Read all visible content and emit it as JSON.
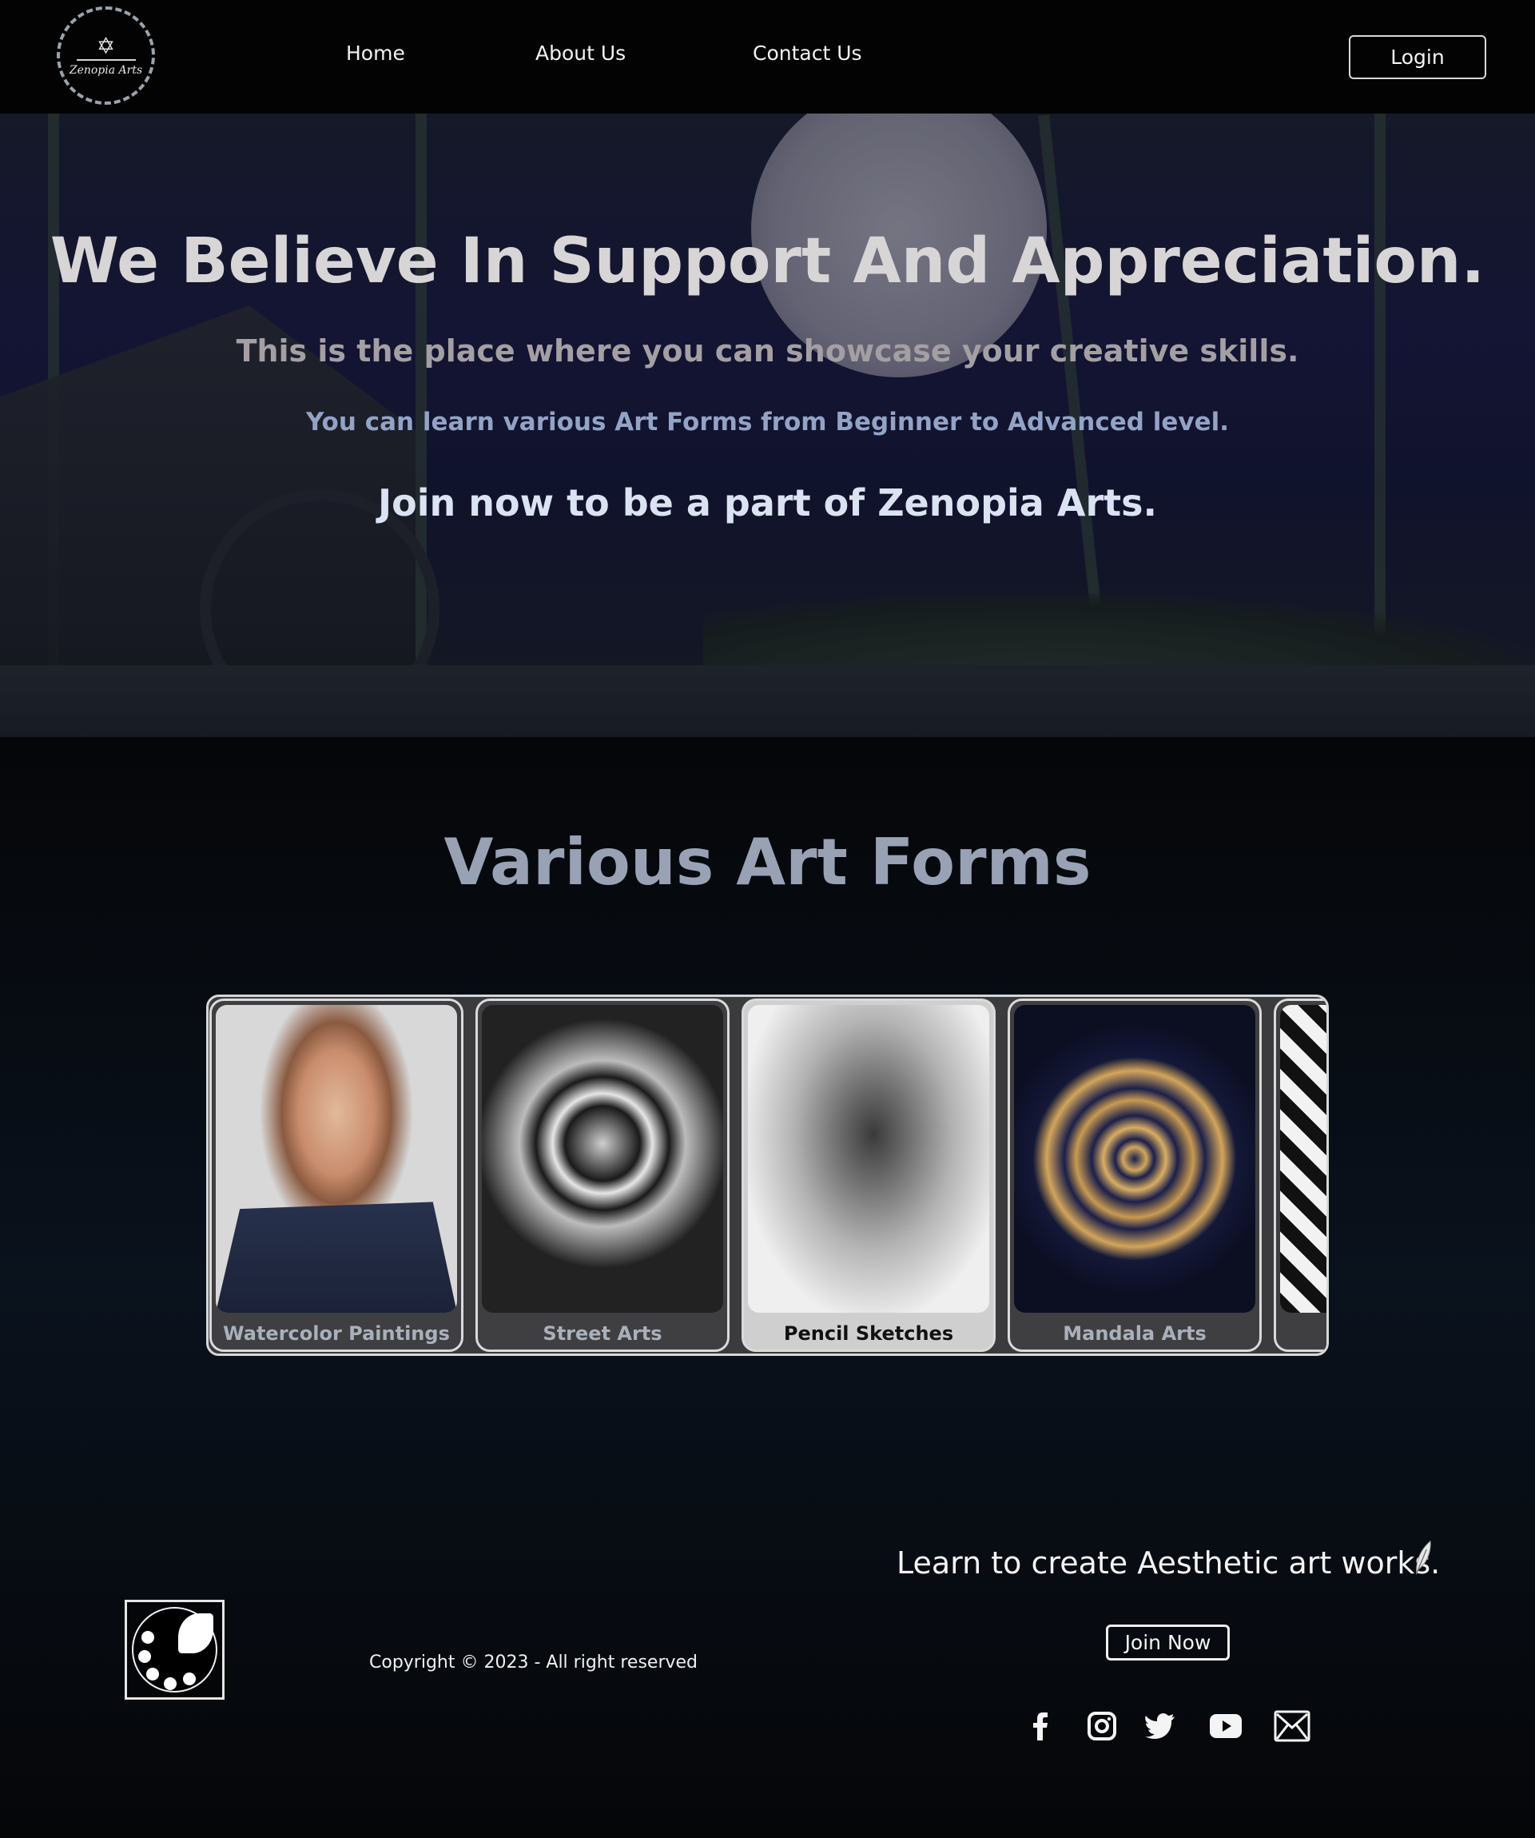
{
  "nav": {
    "logo_text": "Zenopia Arts",
    "links": [
      {
        "label": "Home"
      },
      {
        "label": "About Us"
      },
      {
        "label": "Contact Us"
      }
    ],
    "login_label": "Login"
  },
  "hero": {
    "title": "We Believe In Support And Appreciation.",
    "subtitle": "This is the place where you can showcase your creative skills.",
    "line2": "You can learn various Art Forms from Beginner to Advanced level.",
    "line3": "Join now to be a part of Zenopia Arts."
  },
  "art_forms": {
    "heading": "Various Art Forms",
    "cards": [
      {
        "label": "Watercolor Paintings"
      },
      {
        "label": "Street Arts"
      },
      {
        "label": "Pencil Sketches"
      },
      {
        "label": "Mandala Arts"
      }
    ]
  },
  "footer": {
    "copyright": "Copyright © 2023 - All right reserved",
    "tagline": "Learn to create Aesthetic art works.",
    "join_label": "Join Now",
    "social_icons": [
      "facebook-icon",
      "instagram-icon",
      "twitter-icon",
      "youtube-icon",
      "mail-icon"
    ]
  }
}
